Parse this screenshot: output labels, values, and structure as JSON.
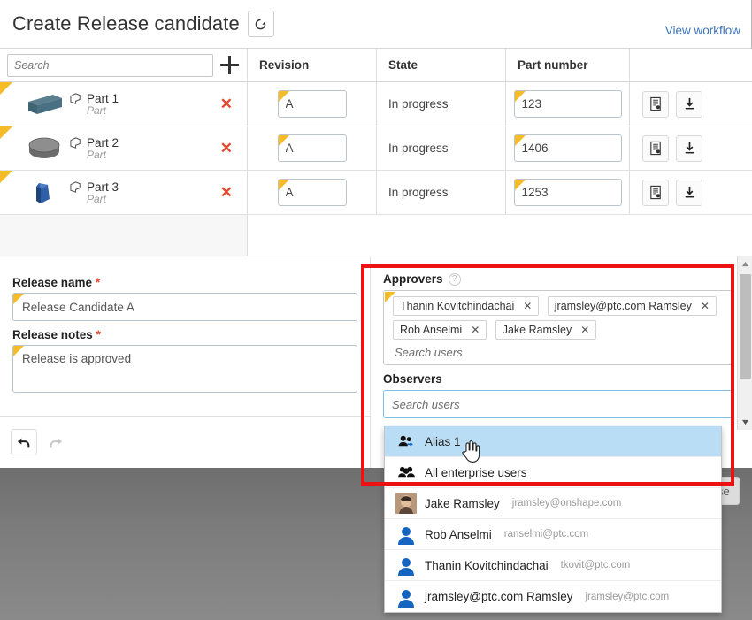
{
  "dialog": {
    "title": "Create Release candidate",
    "refresh_icon": "refresh-icon",
    "view_workflow": "View workflow"
  },
  "table": {
    "search_placeholder": "Search",
    "add_icon": "plus-icon",
    "columns": [
      "",
      "Revision",
      "State",
      "Part number",
      ""
    ],
    "rows": [
      {
        "name": "Part 1",
        "subtitle": "Part",
        "thumb": "box-thumbnail",
        "revision": "A",
        "state": "In progress",
        "part_number": "123",
        "remove_icon": "close-icon",
        "drawing_icon": "drawing-icon",
        "download_icon": "download-icon"
      },
      {
        "name": "Part 2",
        "subtitle": "Part",
        "thumb": "cylinder-thumbnail",
        "revision": "A",
        "state": "In progress",
        "part_number": "1406",
        "remove_icon": "close-icon",
        "drawing_icon": "drawing-icon",
        "download_icon": "download-icon"
      },
      {
        "name": "Part 3",
        "subtitle": "Part",
        "thumb": "wedge-thumbnail",
        "revision": "A",
        "state": "In progress",
        "part_number": "1253",
        "remove_icon": "close-icon",
        "drawing_icon": "drawing-icon",
        "download_icon": "download-icon"
      }
    ]
  },
  "form": {
    "release_name_label": "Release name",
    "release_name_value": "Release Candidate A",
    "release_notes_label": "Release notes",
    "release_notes_value": "Release is approved",
    "required_marker": "*",
    "undo_icon": "undo-arrow-icon",
    "redo_icon": "redo-arrow-icon"
  },
  "approvers": {
    "label": "Approvers",
    "help_icon": "help-question-icon",
    "tokens": [
      "Thanin Kovitchindachai",
      "jramsley@ptc.com Ramsley",
      "Rob Anselmi",
      "Jake Ramsley"
    ],
    "remove_token_icon": "close-small-icon",
    "search_placeholder": "Search users"
  },
  "observers": {
    "label": "Observers",
    "search_placeholder": "Search users",
    "value": ""
  },
  "dropdown": {
    "items": [
      {
        "name": "Alias 1",
        "email": "",
        "icon": "group-alias-icon",
        "selected": true
      },
      {
        "name": "All enterprise users",
        "email": "",
        "icon": "group-icon",
        "selected": false
      },
      {
        "name": "Jake Ramsley",
        "email": "jramsley@onshape.com",
        "icon": "avatar-photo",
        "selected": false
      },
      {
        "name": "Rob Anselmi",
        "email": "ranselmi@ptc.com",
        "icon": "avatar-person-icon",
        "selected": false
      },
      {
        "name": "Thanin Kovitchindachai",
        "email": "tkovit@ptc.com",
        "icon": "avatar-person-icon",
        "selected": false
      },
      {
        "name": "jramsley@ptc.com Ramsley",
        "email": "jramsley@ptc.com",
        "icon": "avatar-person-icon",
        "selected": false
      }
    ]
  },
  "buttons": {
    "release_label": "Release"
  },
  "scrollbar": {
    "up_icon": "triangle-up-icon",
    "down_icon": "triangle-down-icon"
  },
  "colors": {
    "accent_yellow": "#f5bc28",
    "link_blue": "#3b73b9",
    "highlight_red": "#ee1111",
    "selection_blue": "#b9ddf4",
    "danger_red": "#e8472c"
  }
}
